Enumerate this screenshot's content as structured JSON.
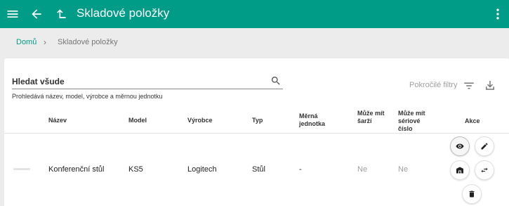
{
  "appbar": {
    "title": "Skladové položky",
    "icons": [
      "menu-icon",
      "arrow-back-icon",
      "arrow-up-icon",
      "more-vert-icon"
    ]
  },
  "breadcrumb": {
    "home": "Domů",
    "separator": "›",
    "current": "Skladové položky"
  },
  "search": {
    "label": "Hledat všude",
    "hint": "Prohledává název, model, výrobce a měrnou jednotku",
    "advanced_filters": "Pokročilé filtry"
  },
  "table": {
    "columns": {
      "name": "Název",
      "model": "Model",
      "manufacturer": "Výrobce",
      "type": "Typ",
      "unit": "Měrná jednotka",
      "batches": "Může mít šarží",
      "serials": "Může mít sériové číslo",
      "actions": "Akce"
    },
    "rows": [
      {
        "name": "Konferenční stůl",
        "model": "KS5",
        "manufacturer": "Logitech",
        "type": "Stůl",
        "unit": "-",
        "batches": "Ne",
        "serials": "Ne"
      }
    ]
  },
  "colors": {
    "accent": "#009c88",
    "background": "#ececec",
    "muted": "#9e9e9e"
  }
}
